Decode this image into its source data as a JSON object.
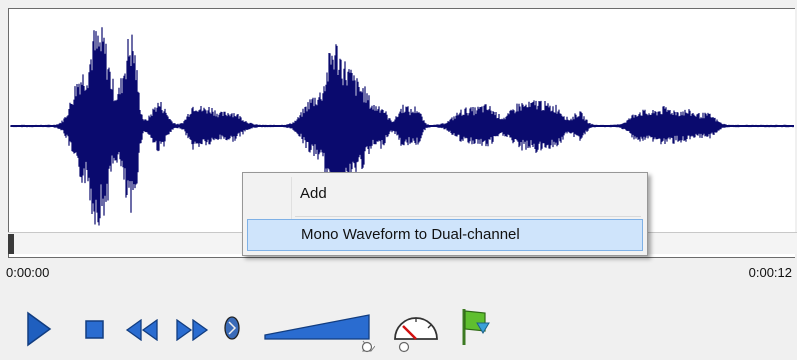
{
  "waveform": {
    "color": "#0a0a6e",
    "time_start": "0:00:00",
    "time_end": "0:00:12"
  },
  "context_menu": {
    "items": [
      {
        "label": "Add"
      },
      {
        "label": "Mono Waveform to Dual-channel"
      }
    ],
    "highlight_color": "#cfe4fb"
  },
  "controls": {
    "buttons": [
      {
        "icon": "play-icon"
      },
      {
        "icon": "stop-icon"
      },
      {
        "icon": "rewind-icon"
      },
      {
        "icon": "fast-forward-icon"
      },
      {
        "icon": "record-marker-icon"
      },
      {
        "icon": "volume-slider-icon"
      },
      {
        "icon": "speed-gauge-icon"
      },
      {
        "icon": "green-flag-icon"
      }
    ],
    "accent_color": "#1f5fbf"
  }
}
